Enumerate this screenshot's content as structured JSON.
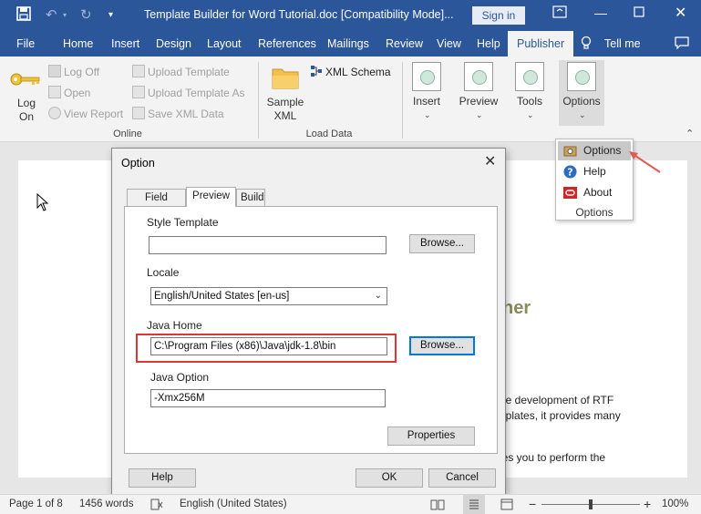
{
  "window": {
    "title": "Template Builder for Word Tutorial.doc [Compatibility Mode]...",
    "sign_in": "Sign in"
  },
  "menu": {
    "items": [
      "File",
      "Home",
      "Insert",
      "Design",
      "Layout",
      "References",
      "Mailings",
      "Review",
      "View",
      "Help",
      "Publisher",
      "Tell me"
    ],
    "active": "Publisher"
  },
  "ribbon": {
    "online": {
      "log_on": "Log On",
      "log_off": "Log Off",
      "open": "Open",
      "view_report": "View Report",
      "upload_template": "Upload Template",
      "upload_template_as": "Upload Template As",
      "save_xml_data": "Save XML Data",
      "group": "Online"
    },
    "load_data": {
      "sample_xml": "Sample XML",
      "xml_schema": "XML Schema",
      "group": "Load Data"
    },
    "insert": "Insert",
    "preview": "Preview",
    "tools": "Tools",
    "options": "Options"
  },
  "options_menu": {
    "items": [
      "Options",
      "Help",
      "About"
    ],
    "footer": "Options"
  },
  "dialog": {
    "title": "Option",
    "tabs": [
      "Field Labels",
      "Preview",
      "Build"
    ],
    "active_tab": "Preview",
    "style_template_label": "Style Template",
    "style_template_value": "",
    "browse": "Browse...",
    "locale_label": "Locale",
    "locale_value": "English/United States [en-us]",
    "java_home_label": "Java Home",
    "java_home_value": "C:\\Program Files (x86)\\Java\\jdk-1.8\\bin",
    "java_option_label": "Java Option",
    "java_option_value": "-Xmx256M",
    "properties": "Properties",
    "help": "Help",
    "ok": "OK",
    "cancel": "Cancel"
  },
  "document": {
    "heading_fragment": "her",
    "lines": [
      "he development of RTF",
      "nplates, it provides many",
      "les you to perform the"
    ]
  },
  "statusbar": {
    "page": "Page 1 of 8",
    "words": "1456 words",
    "language": "English (United States)",
    "zoom": "100%"
  },
  "colors": {
    "brand": "#2b579a",
    "highlight_box": "#e03535",
    "arrow": "#e05a5a"
  }
}
